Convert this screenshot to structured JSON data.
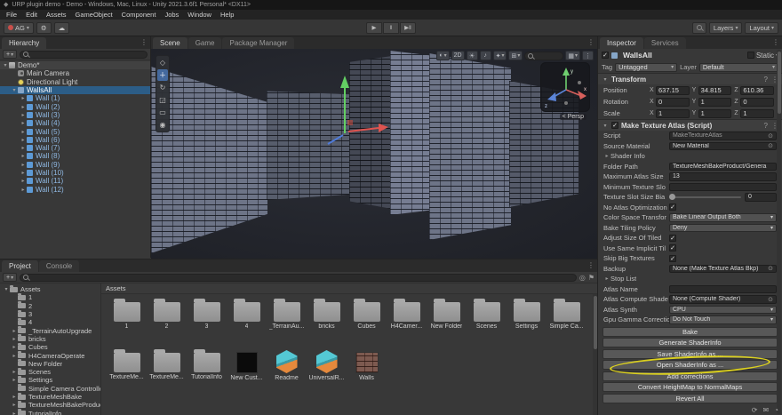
{
  "window": {
    "title": "URP plugin demo - Demo - Windows, Mac, Linux - Unity 2021.3.6f1 Personal* <DX11>",
    "menus": [
      "File",
      "Edit",
      "Assets",
      "GameObject",
      "Component",
      "Jobs",
      "Window",
      "Help"
    ]
  },
  "toolbar": {
    "account_label": "AG",
    "layers_label": "Layers",
    "layout_label": "Layout"
  },
  "hierarchy": {
    "tab_label": "Hierarchy",
    "items": [
      {
        "label": "Demo*",
        "depth": 0,
        "kind": "scene",
        "expanded": true
      },
      {
        "label": "Main Camera",
        "depth": 1,
        "kind": "camera"
      },
      {
        "label": "Directional Light",
        "depth": 1,
        "kind": "light"
      },
      {
        "label": "WallsAll",
        "depth": 1,
        "kind": "object",
        "selected": true,
        "expanded": true
      },
      {
        "label": "Wall (1)",
        "depth": 2,
        "kind": "prefab",
        "expandable": true
      },
      {
        "label": "Wall (2)",
        "depth": 2,
        "kind": "prefab",
        "expandable": true
      },
      {
        "label": "Wall (3)",
        "depth": 2,
        "kind": "prefab",
        "expandable": true
      },
      {
        "label": "Wall (4)",
        "depth": 2,
        "kind": "prefab",
        "expandable": true
      },
      {
        "label": "Wall (5)",
        "depth": 2,
        "kind": "prefab",
        "expandable": true
      },
      {
        "label": "Wall (6)",
        "depth": 2,
        "kind": "prefab",
        "expandable": true
      },
      {
        "label": "Wall (7)",
        "depth": 2,
        "kind": "prefab",
        "expandable": true
      },
      {
        "label": "Wall (8)",
        "depth": 2,
        "kind": "prefab",
        "expandable": true
      },
      {
        "label": "Wall (9)",
        "depth": 2,
        "kind": "prefab",
        "expandable": true
      },
      {
        "label": "Wall (10)",
        "depth": 2,
        "kind": "prefab",
        "expandable": true
      },
      {
        "label": "Wall (11)",
        "depth": 2,
        "kind": "prefab",
        "expandable": true
      },
      {
        "label": "Wall (12)",
        "depth": 2,
        "kind": "prefab",
        "expandable": true
      }
    ]
  },
  "scene_view": {
    "tabs": [
      {
        "label": "Scene",
        "active": true
      },
      {
        "label": "Game",
        "active": false
      },
      {
        "label": "Package Manager",
        "active": false
      }
    ],
    "toolbar_2d_label": "2D",
    "gizmo_label": "< Persp",
    "axis_x": "x",
    "axis_y": "y",
    "axis_z": "z"
  },
  "inspector": {
    "tabs": [
      {
        "label": "Inspector",
        "active": true
      },
      {
        "label": "Services",
        "active": false
      }
    ],
    "header": {
      "name": "WallsAll",
      "static_label": "Static"
    },
    "tag_label": "Tag",
    "tag_value": "Untagged",
    "layer_label": "Layer",
    "layer_value": "Default",
    "transform": {
      "title": "Transform",
      "axis_labels": [
        "X",
        "Y",
        "Z"
      ],
      "rows": [
        {
          "label": "Position",
          "x": "637.15",
          "y": "34.815",
          "z": "610.36"
        },
        {
          "label": "Rotation",
          "x": "0",
          "y": "1",
          "z": "0"
        },
        {
          "label": "Scale",
          "x": "1",
          "y": "1",
          "z": "1"
        }
      ]
    },
    "script_component": {
      "title": "Make Texture Atlas (Script)",
      "fields": [
        {
          "label": "Script",
          "type": "object",
          "value": "MakeTextureAtlas",
          "disabled": true
        },
        {
          "label": "Source Material",
          "type": "object",
          "value": "New Material"
        },
        {
          "label": "Shader Info",
          "type": "foldout"
        },
        {
          "label": "Folder Path",
          "type": "text",
          "value": "TextureMeshBakeProduct/Genera"
        },
        {
          "label": "Maximum Atlas Size",
          "type": "text",
          "value": "13"
        },
        {
          "label": "Minimum Texture Slo",
          "type": "text",
          "value": ""
        },
        {
          "label": "Texture Slot Size Bia",
          "type": "slider",
          "value": "0"
        },
        {
          "label": "No Atlas Optimization",
          "type": "checkbox",
          "checked": true
        },
        {
          "label": "Color Space Transfor",
          "type": "dropdown",
          "value": "Bake Linear Output Both"
        },
        {
          "label": "Bake Tiling Policy",
          "type": "dropdown",
          "value": "Deny"
        },
        {
          "label": "Adjust Size Of Tiled",
          "type": "checkbox",
          "checked": true
        },
        {
          "label": "Use Same Implicit Til",
          "type": "checkbox",
          "checked": true
        },
        {
          "label": "Skip Big Textures",
          "type": "checkbox",
          "checked": true
        },
        {
          "label": "Backup",
          "type": "object",
          "value": "None (Make Texture Atlas Bkp)"
        },
        {
          "label": "Stop List",
          "type": "foldout"
        },
        {
          "label": "Atlas Name",
          "type": "text",
          "value": ""
        },
        {
          "label": "Atlas Compute Shade",
          "type": "object",
          "value": "None (Compute Shader)"
        },
        {
          "label": "Atlas Synth",
          "type": "dropdown",
          "value": "CPU"
        },
        {
          "label": "Gpu Gamma Correctio",
          "type": "dropdown",
          "value": "Do Not Touch"
        }
      ],
      "buttons": [
        {
          "label": "Bake"
        },
        {
          "label": "Generate ShaderInfo"
        },
        {
          "label": "Save ShaderInfo as ..."
        },
        {
          "label": "Open ShaderInfo as ...",
          "circled": true
        },
        {
          "label": "Add corrections"
        },
        {
          "label": "Convert HeightMap to NormalMaps"
        },
        {
          "label": "Revert All"
        }
      ],
      "annotation_color": "#e4d81c"
    }
  },
  "project": {
    "tabs": [
      {
        "label": "Project",
        "active": true
      },
      {
        "label": "Console",
        "active": false
      }
    ],
    "breadcrumb": "Assets",
    "tree": [
      {
        "label": "Assets",
        "depth": 0,
        "expanded": true
      },
      {
        "label": "1",
        "depth": 1
      },
      {
        "label": "2",
        "depth": 1
      },
      {
        "label": "3",
        "depth": 1
      },
      {
        "label": "4",
        "depth": 1
      },
      {
        "label": "_TerrainAutoUpgrade",
        "depth": 1,
        "expandable": true
      },
      {
        "label": "bricks",
        "depth": 1,
        "expandable": true
      },
      {
        "label": "Cubes",
        "depth": 1,
        "expandable": true
      },
      {
        "label": "H4CameraOperate",
        "depth": 1,
        "expandable": true
      },
      {
        "label": "New Folder",
        "depth": 1
      },
      {
        "label": "Scenes",
        "depth": 1,
        "expandable": true
      },
      {
        "label": "Settings",
        "depth": 1,
        "expandable": true
      },
      {
        "label": "Simple Camera Controller",
        "depth": 1
      },
      {
        "label": "TextureMeshBake",
        "depth": 1,
        "expandable": true
      },
      {
        "label": "TextureMeshBakeProduc",
        "depth": 1,
        "expandable": true
      },
      {
        "label": "TutorialInfo",
        "depth": 1,
        "expandable": true
      }
    ],
    "grid": [
      {
        "label": "1",
        "icon": "folder"
      },
      {
        "label": "2",
        "icon": "folder"
      },
      {
        "label": "3",
        "icon": "folder"
      },
      {
        "label": "4",
        "icon": "folder"
      },
      {
        "label": "_TerrainAu...",
        "icon": "folder"
      },
      {
        "label": "bricks",
        "icon": "folder"
      },
      {
        "label": "Cubes",
        "icon": "folder"
      },
      {
        "label": "H4Camer...",
        "icon": "folder"
      },
      {
        "label": "New Folder",
        "icon": "folder"
      },
      {
        "label": "Scenes",
        "icon": "folder"
      },
      {
        "label": "Settings",
        "icon": "folder"
      },
      {
        "label": "Simple Ca...",
        "icon": "folder"
      },
      {
        "label": "TextureMe...",
        "icon": "folder"
      },
      {
        "label": "TextureMe...",
        "icon": "folder"
      },
      {
        "label": "TutorialInfo",
        "icon": "folder"
      },
      {
        "label": "New Cust...",
        "icon": "black"
      },
      {
        "label": "Readme",
        "icon": "asset"
      },
      {
        "label": "UniversalR...",
        "icon": "asset"
      },
      {
        "label": "Walls",
        "icon": "texture"
      }
    ]
  }
}
